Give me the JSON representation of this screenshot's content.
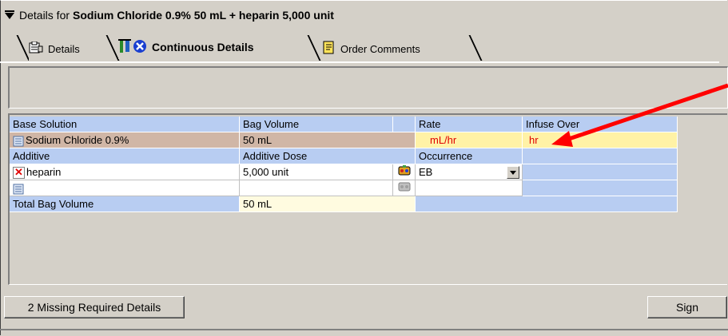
{
  "header": {
    "details_for_label": "Details for",
    "order_name": "Sodium Chloride 0.9% 50 mL + heparin 5,000 unit"
  },
  "tabs": [
    {
      "label": "Details",
      "icon": "details-sheet-icon"
    },
    {
      "label": "Continuous Details",
      "icon": "iv-bag-error-icon"
    },
    {
      "label": "Order Comments",
      "icon": "comment-notes-icon"
    }
  ],
  "grid": {
    "headers1": [
      "Base Solution",
      "Bag Volume",
      "Rate",
      "Infuse Over"
    ],
    "base_row": {
      "solution": "Sodium Chloride 0.9%",
      "bag_volume": "50 mL",
      "rate_unit": "mL/hr",
      "infuse_unit": "hr"
    },
    "headers2": [
      "Additive",
      "Additive Dose",
      "Occurrence"
    ],
    "additive_row": {
      "additive": "heparin",
      "dose": "5,000 unit",
      "occurrence": "EB"
    },
    "total_label": "Total Bag Volume",
    "total_value": "50 mL"
  },
  "buttons": {
    "missing": "2 Missing Required Details",
    "sign": "Sign"
  },
  "colors": {
    "header_blue": "#b8cdf2",
    "base_row_brown": "#d0b6a6",
    "required_yellow": "#fff2a6",
    "required_text_red": "#e00000",
    "annotation_arrow": "#ff0000"
  }
}
